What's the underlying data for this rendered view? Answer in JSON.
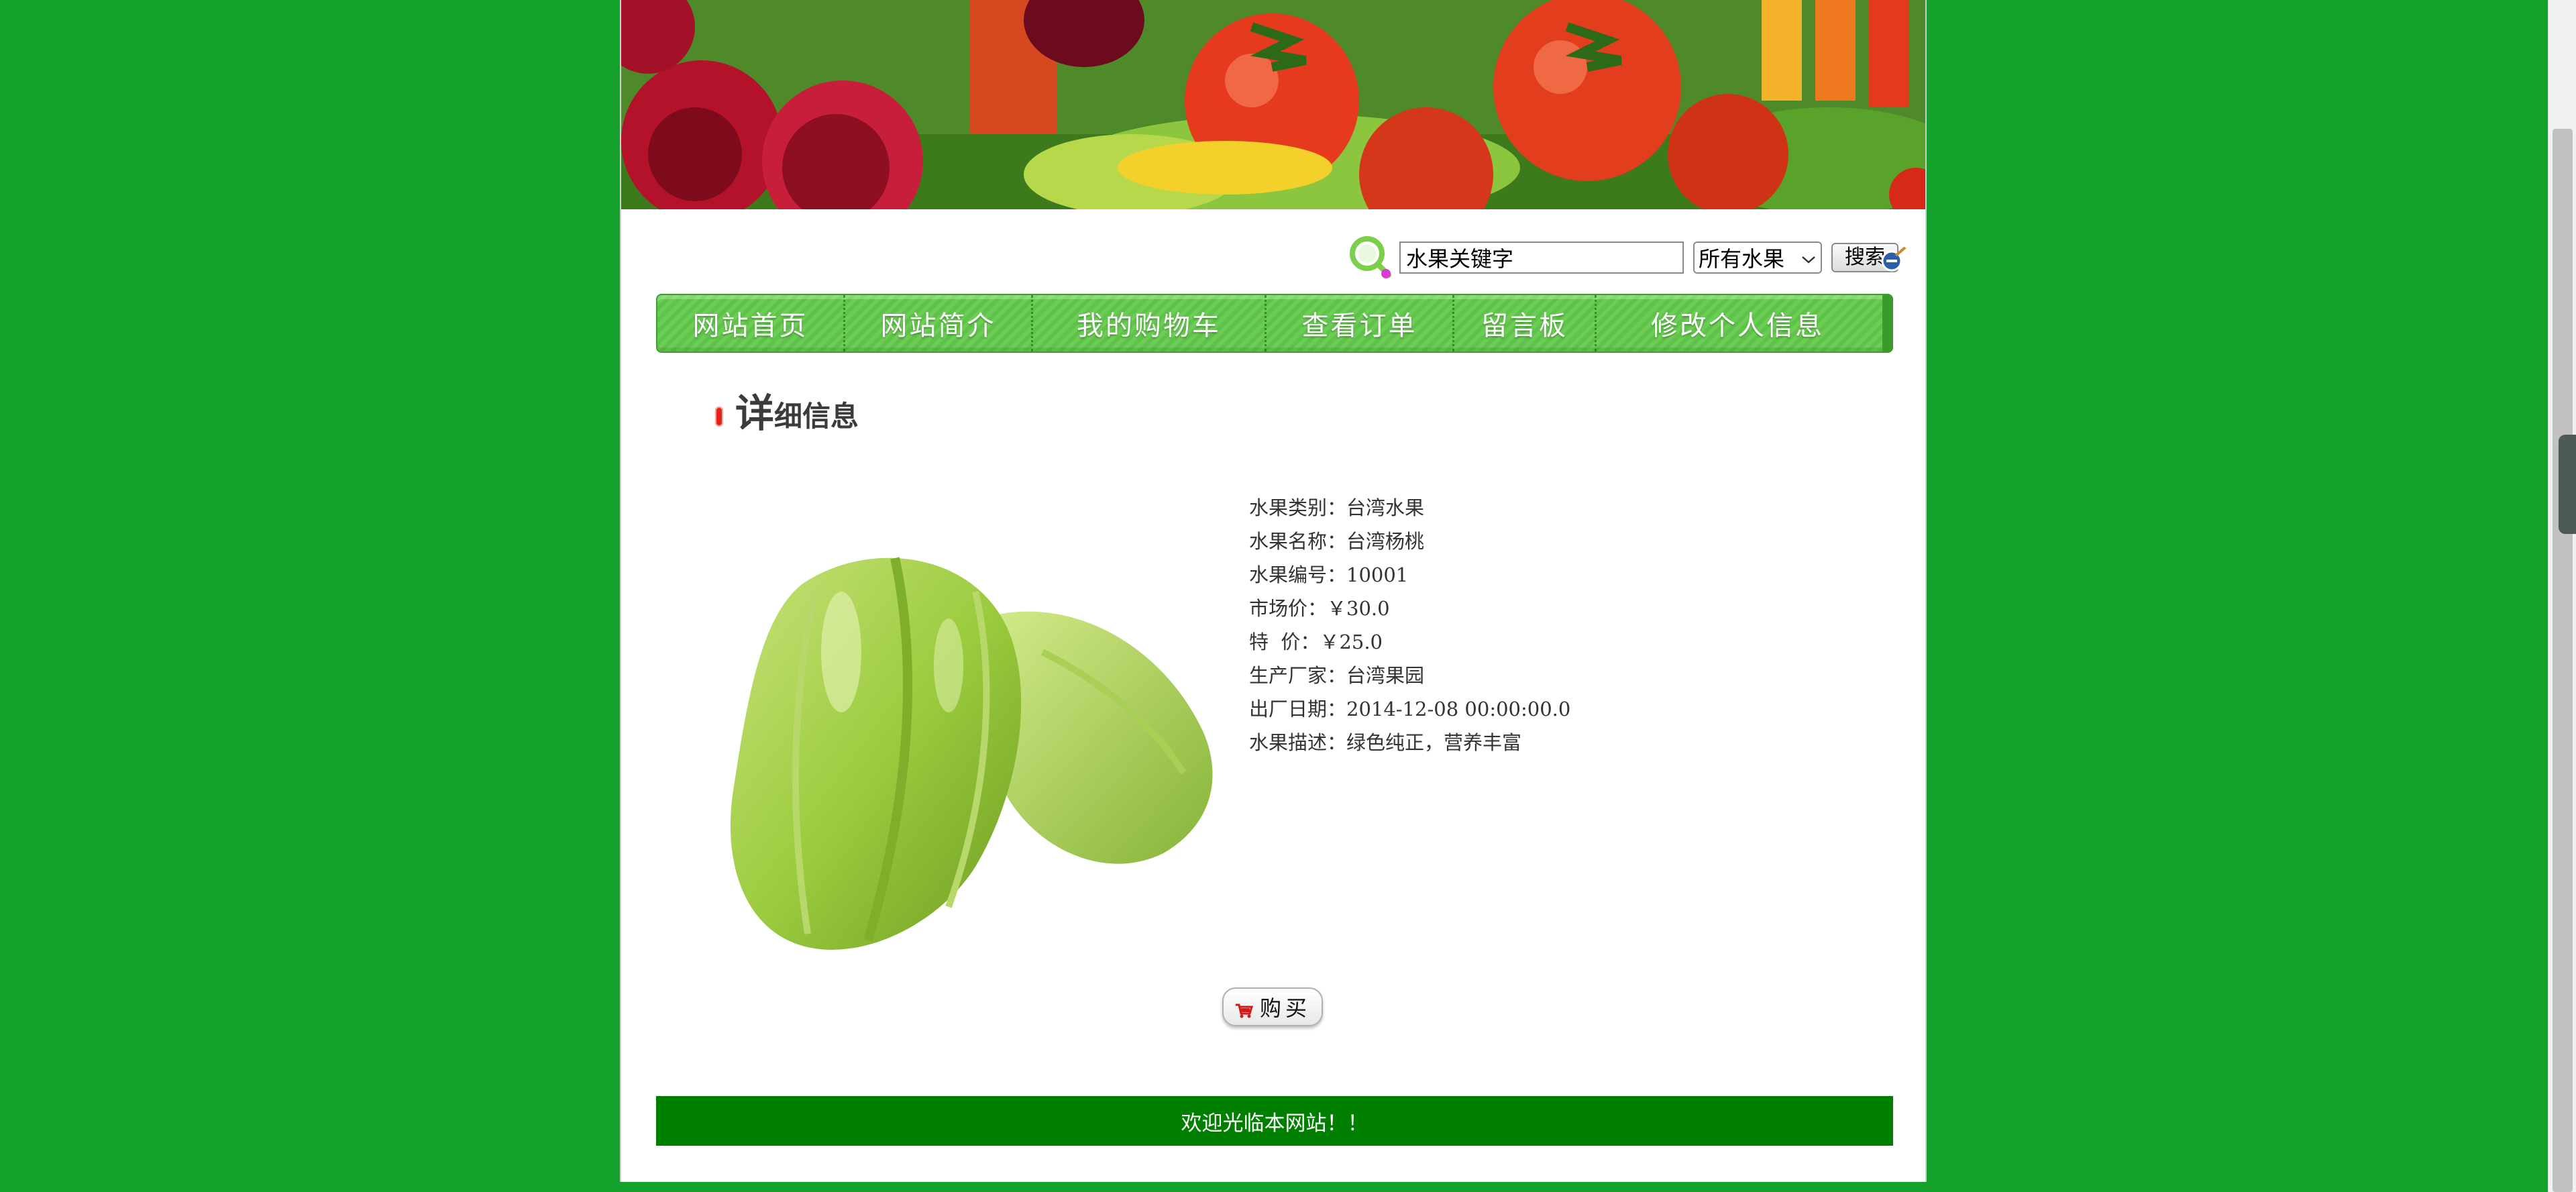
{
  "search": {
    "placeholder_value": "水果关键字",
    "category_selected": "所有水果",
    "button_label": "搜索"
  },
  "nav": {
    "items": [
      {
        "label": "网站首页"
      },
      {
        "label": "网站简介"
      },
      {
        "label": "我的购物车"
      },
      {
        "label": "查看订单"
      },
      {
        "label": "留言板"
      },
      {
        "label": "修改个人信息"
      }
    ]
  },
  "detail": {
    "heading_big": "详",
    "heading_small": "细信息",
    "lines": [
      "水果类别：台湾水果",
      "水果名称：台湾杨桃",
      "水果编号：10001",
      "市场价：￥30.0",
      "特  价：￥25.0",
      "生产厂家：台湾果园",
      "出厂日期：2014-12-08 00:00:00.0",
      "水果描述：绿色纯正，营养丰富"
    ]
  },
  "buy": {
    "label": "购买"
  },
  "footer": {
    "text": "欢迎光临本网站！！"
  },
  "colors": {
    "background": "#14a22c",
    "nav_green": "#5fc24a",
    "footer_green": "#017f01"
  }
}
